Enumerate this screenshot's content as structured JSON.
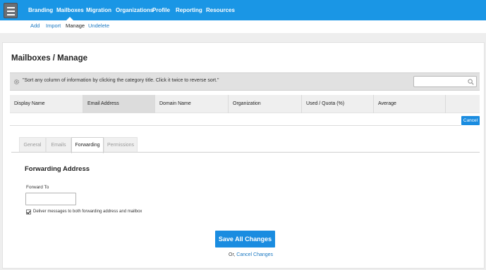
{
  "topnav": {
    "items": [
      {
        "label": "Branding",
        "active": false
      },
      {
        "label": "Mailboxes",
        "active": true
      },
      {
        "label": "Migration",
        "active": false
      },
      {
        "label": "Organizations",
        "active": false
      },
      {
        "label": "Profile",
        "active": false
      },
      {
        "label": "Reporting",
        "active": false
      },
      {
        "label": "Resources",
        "active": false
      }
    ]
  },
  "subnav": {
    "items": [
      {
        "label": "Add"
      },
      {
        "label": "Import"
      },
      {
        "label": "Manage"
      },
      {
        "label": "Undelete"
      }
    ]
  },
  "page": {
    "title": "Mailboxes / Manage"
  },
  "info": {
    "hint": "\"Sort any column of information by clicking the category title. Click it twice to reverse sort.\"",
    "search_value": ""
  },
  "table": {
    "columns": [
      "Display Name",
      "Email Address",
      "Domain Name",
      "Organization",
      "Used / Quota (%)",
      "Average"
    ],
    "sorted_column": "Email Address",
    "cancel_label": "Cancel"
  },
  "tabs": [
    {
      "label": "General",
      "active": false
    },
    {
      "label": "Emails",
      "active": false
    },
    {
      "label": "Forwarding",
      "active": true
    },
    {
      "label": "Permissions",
      "active": false
    }
  ],
  "forwarding": {
    "section_title": "Forwarding Address",
    "field_label": "Forward To",
    "field_value": "",
    "checkbox_label": "Deliver messages to both forwarding address and mailbox",
    "checkbox_checked": true
  },
  "actions": {
    "save_label": "Save All Changes",
    "or_label": "Or,",
    "cancel_changes_label": "Cancel Changes"
  },
  "colors": {
    "accent": "#1a96e5",
    "button": "#1a8ce0",
    "link": "#1a78c2"
  },
  "icons": {
    "menu": "hamburger-menu-icon",
    "info": "gear-icon",
    "search": "search-icon"
  }
}
